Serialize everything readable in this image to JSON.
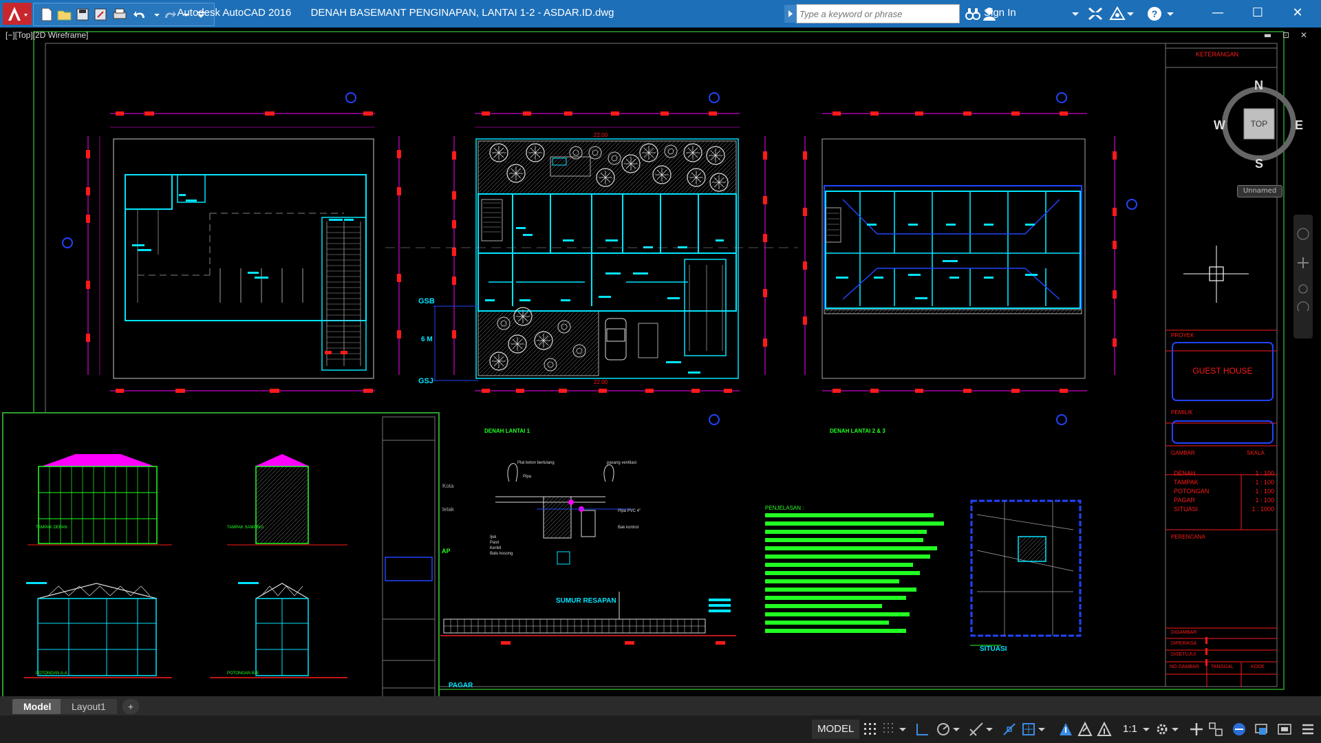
{
  "window": {
    "app_title": "Autodesk AutoCAD 2016",
    "file_title": "DENAH BASEMANT PENGINAPAN, LANTAI 1-2 - ASDAR.ID.dwg",
    "minimize": "—",
    "maximize": "☐",
    "close": "✕"
  },
  "search": {
    "placeholder": "Type a keyword or phrase"
  },
  "account": {
    "signin": "Sign In"
  },
  "viewport": {
    "label": "[−][Top][2D Wireframe]",
    "controls": "▬ ⊡ ✕"
  },
  "viewcube": {
    "north": "N",
    "south": "S",
    "east": "E",
    "west": "W",
    "top": "TOP",
    "ucs": "Unnamed"
  },
  "tabs": {
    "model": "Model",
    "layout1": "Layout1",
    "add": "+"
  },
  "status": {
    "model": "MODEL",
    "scale": "1:1"
  },
  "drawing": {
    "dim_22": "22.00",
    "gsb": "GSB",
    "gsj": "GSJ",
    "six_m": "6 M",
    "denah_lantai_1": "DENAH LANTAI 1",
    "denah_lantai_2": "DENAH LANTAI 2 & 3",
    "sumur_resapan": "SUMUR RESAPAN",
    "pagar": "PAGAR",
    "situasi": "SITUASI",
    "penjelasan": "PENJELASAN :",
    "kota": "Kota",
    "letak": "letak",
    "ap": "AP",
    "plat_beton": "Plat beton bertulang",
    "pasangan": "pasang ventilasi",
    "pipa": "Pipa",
    "pipa_pvc": "Pipa PVC 4\"",
    "ijuk": "Ijuk",
    "pasir": "Pasir",
    "kerikil": "Kerikil",
    "batu_kosong": "Batu kosong",
    "bak_kontrol": "Bak kontrol",
    "pipa_pvc_size": "Pipa PVC 4\"",
    "elev_label": "TAMPAK DEPAN",
    "elev_samping": "TAMPAK SAMPING",
    "potongan_a": "POTONGAN A-A",
    "potongan_b": "POTONGAN B-B"
  },
  "title_block": {
    "keterangan": "KETERANGAN",
    "proyek": "PROYEK",
    "guest_house": "GUEST HOUSE",
    "pemilik": "PEMILIK",
    "gambar": "GAMBAR",
    "skala": "SKALA",
    "items": [
      {
        "name": "DENAH",
        "scale": "1 : 100"
      },
      {
        "name": "TAMPAK",
        "scale": "1 : 100"
      },
      {
        "name": "POTONGAN",
        "scale": "1 : 100"
      },
      {
        "name": "PAGAR",
        "scale": "1 : 100"
      },
      {
        "name": "SITUASI",
        "scale": "1 : 1000"
      }
    ],
    "perencana": "PERENCANA",
    "digambar": "DIGAMBAR",
    "diperiksa": "DIPERIKSA",
    "disetujui": "DISETUJUI",
    "no_gambar": "NO GAMBAR",
    "tanggal": "TANGGAL",
    "kode": "KODE"
  },
  "colors": {
    "cyan": "#00e5ff",
    "red": "#ff1a1a",
    "magenta": "#ff00ff",
    "green": "#22ff22",
    "blue": "#2244ff",
    "frame": "#3a3a3a",
    "border_green": "#2ea02e"
  }
}
